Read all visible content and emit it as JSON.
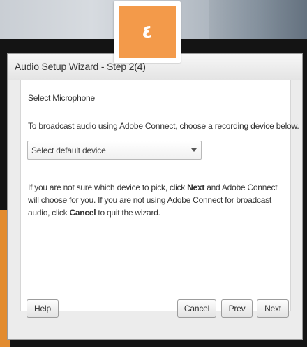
{
  "step_badge": {
    "glyph": "٤",
    "color": "#f39a4a"
  },
  "dialog": {
    "title": "Audio Setup Wizard - Step 2(4)",
    "section_heading": "Select Microphone",
    "instructions": "To broadcast audio using Adobe Connect, choose a recording device below.",
    "device_select": {
      "selected": "Select default device"
    },
    "help_text": {
      "part1": "If you are not sure which device to pick, click ",
      "next_word": "Next",
      "part2": " and Adobe Connect will choose for you. If you are not using Adobe Connect for broadcast audio, click ",
      "cancel_word": "Cancel",
      "part3": " to quit the wizard."
    },
    "buttons": {
      "help": "Help",
      "cancel": "Cancel",
      "prev": "Prev",
      "next": "Next"
    }
  }
}
